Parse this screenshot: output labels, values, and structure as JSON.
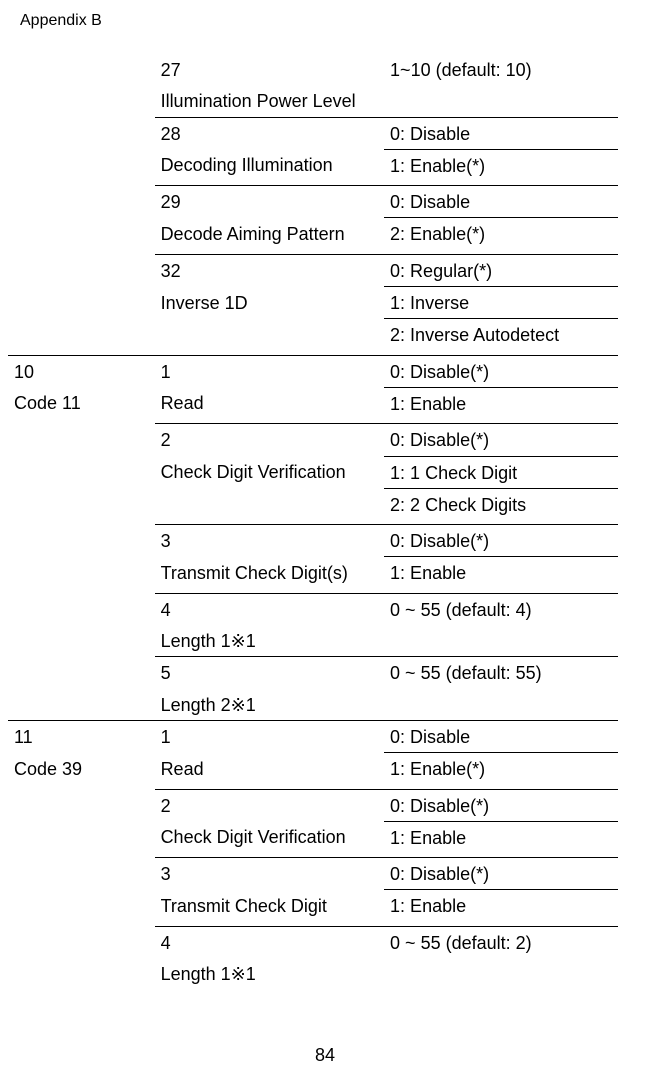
{
  "header": "Appendix B",
  "footer": "84",
  "rows": [
    {
      "a": "",
      "aCls": "",
      "b": "27",
      "bCls": "",
      "c": "1~10 (default: 10)",
      "cCls": "",
      "spacer": false
    },
    {
      "a": "",
      "aCls": "",
      "b": "Illumination Power Level",
      "bCls": "pad-top-gap",
      "c": "",
      "cCls": "",
      "spacer": false
    },
    {
      "a": "",
      "aCls": "",
      "b": "28",
      "bCls": "bt",
      "c": "0: Disable",
      "cCls": "bt",
      "spacer": false
    },
    {
      "a": "",
      "aCls": "",
      "b": "Decoding Illumination",
      "bCls": "",
      "c": "1: Enable(*)",
      "cCls": "bt",
      "spacer": false
    },
    {
      "spacer": true
    },
    {
      "a": "",
      "aCls": "",
      "b": "29",
      "bCls": "bt",
      "c": "0: Disable",
      "cCls": "bt",
      "spacer": false
    },
    {
      "a": "",
      "aCls": "",
      "b": "Decode Aiming Pattern",
      "bCls": "",
      "c": "2: Enable(*)",
      "cCls": "bt",
      "spacer": false
    },
    {
      "spacer": true
    },
    {
      "a": "",
      "aCls": "",
      "b": "32",
      "bCls": "bt",
      "c": "0: Regular(*)",
      "cCls": "bt",
      "spacer": false
    },
    {
      "a": "",
      "aCls": "",
      "b": "Inverse 1D",
      "bCls": "",
      "c": "1: Inverse",
      "cCls": "bt",
      "spacer": false
    },
    {
      "a": "",
      "aCls": "",
      "b": "",
      "bCls": "",
      "c": "2: Inverse Autodetect",
      "cCls": "bt",
      "spacer": false
    },
    {
      "spacer": true
    },
    {
      "a": "10",
      "aCls": "bt",
      "b": "1",
      "bCls": "bt",
      "c": "0: Disable(*)",
      "cCls": "bt",
      "spacer": false
    },
    {
      "a": "Code 11",
      "aCls": "",
      "b": "Read",
      "bCls": "",
      "c": "1: Enable",
      "cCls": "bt",
      "spacer": false
    },
    {
      "spacer": true
    },
    {
      "a": "",
      "aCls": "",
      "b": "2",
      "bCls": "bt",
      "c": "0: Disable(*)",
      "cCls": "bt",
      "spacer": false
    },
    {
      "a": "",
      "aCls": "",
      "b": "Check Digit Verification",
      "bCls": "",
      "c": "1: 1 Check Digit",
      "cCls": "bt",
      "spacer": false
    },
    {
      "a": "",
      "aCls": "",
      "b": "",
      "bCls": "",
      "c": "2: 2 Check Digits",
      "cCls": "bt",
      "spacer": false
    },
    {
      "spacer": true
    },
    {
      "a": "",
      "aCls": "",
      "b": "3",
      "bCls": "bt",
      "c": "0: Disable(*)",
      "cCls": "bt",
      "spacer": false
    },
    {
      "a": "",
      "aCls": "",
      "b": "Transmit Check Digit(s)",
      "bCls": "",
      "c": "1: Enable",
      "cCls": "bt",
      "spacer": false
    },
    {
      "spacer": true
    },
    {
      "a": "",
      "aCls": "",
      "b": "4",
      "bCls": "bt",
      "c": "0 ~ 55 (default: 4)",
      "cCls": "bt",
      "spacer": false
    },
    {
      "a": "",
      "aCls": "",
      "b": "Length 1※1",
      "bCls": "pad-top-gap",
      "c": "",
      "cCls": "",
      "spacer": false
    },
    {
      "a": "",
      "aCls": "",
      "b": "5",
      "bCls": "bt",
      "c": "0 ~ 55 (default: 55)",
      "cCls": "bt",
      "spacer": false
    },
    {
      "a": "",
      "aCls": "",
      "b": "Length 2※1",
      "bCls": "pad-top-gap",
      "c": "",
      "cCls": "",
      "spacer": false
    },
    {
      "a": "11",
      "aCls": "bt",
      "b": "1",
      "bCls": "bt",
      "c": "0: Disable",
      "cCls": "bt",
      "spacer": false
    },
    {
      "a": "Code 39",
      "aCls": "",
      "b": "Read",
      "bCls": "",
      "c": "1: Enable(*)",
      "cCls": "bt",
      "spacer": false
    },
    {
      "spacer": true
    },
    {
      "a": "",
      "aCls": "",
      "b": "2",
      "bCls": "bt",
      "c": "0: Disable(*)",
      "cCls": "bt",
      "spacer": false
    },
    {
      "a": "",
      "aCls": "",
      "b": "Check Digit Verification",
      "bCls": "",
      "c": "1: Enable",
      "cCls": "bt",
      "spacer": false
    },
    {
      "spacer": true
    },
    {
      "a": "",
      "aCls": "",
      "b": "3",
      "bCls": "bt",
      "c": "0: Disable(*)",
      "cCls": "bt",
      "spacer": false
    },
    {
      "a": "",
      "aCls": "",
      "b": "Transmit Check Digit",
      "bCls": "",
      "c": "1: Enable",
      "cCls": "bt",
      "spacer": false
    },
    {
      "spacer": true
    },
    {
      "a": "",
      "aCls": "",
      "b": "4",
      "bCls": "bt",
      "c": "0 ~ 55 (default: 2)",
      "cCls": "bt",
      "spacer": false
    },
    {
      "a": "",
      "aCls": "",
      "b": "Length 1※1",
      "bCls": "pad-top-gap",
      "c": "",
      "cCls": "",
      "spacer": false
    }
  ]
}
